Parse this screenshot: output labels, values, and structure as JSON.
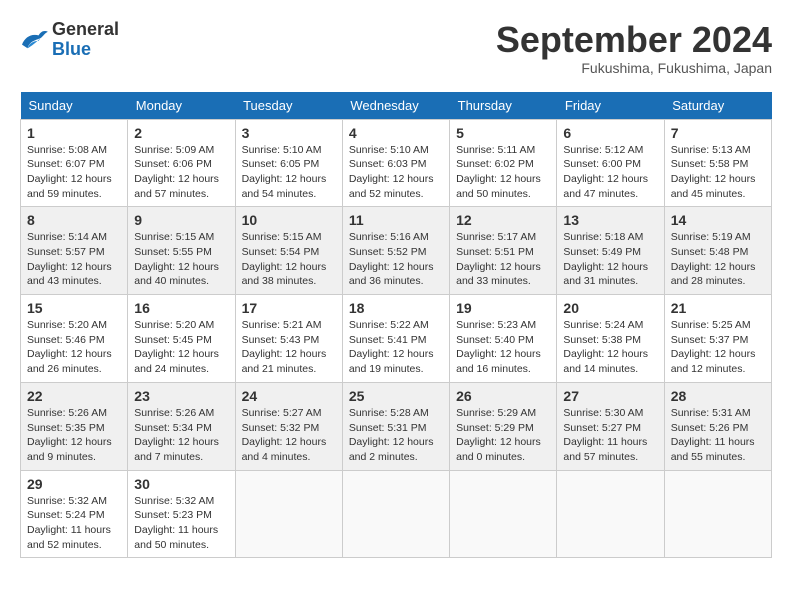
{
  "header": {
    "logo_line1": "General",
    "logo_line2": "Blue",
    "month_title": "September 2024",
    "subtitle": "Fukushima, Fukushima, Japan"
  },
  "days_of_week": [
    "Sunday",
    "Monday",
    "Tuesday",
    "Wednesday",
    "Thursday",
    "Friday",
    "Saturday"
  ],
  "weeks": [
    [
      {
        "day": "1",
        "sunrise": "Sunrise: 5:08 AM",
        "sunset": "Sunset: 6:07 PM",
        "daylight": "Daylight: 12 hours and 59 minutes."
      },
      {
        "day": "2",
        "sunrise": "Sunrise: 5:09 AM",
        "sunset": "Sunset: 6:06 PM",
        "daylight": "Daylight: 12 hours and 57 minutes."
      },
      {
        "day": "3",
        "sunrise": "Sunrise: 5:10 AM",
        "sunset": "Sunset: 6:05 PM",
        "daylight": "Daylight: 12 hours and 54 minutes."
      },
      {
        "day": "4",
        "sunrise": "Sunrise: 5:10 AM",
        "sunset": "Sunset: 6:03 PM",
        "daylight": "Daylight: 12 hours and 52 minutes."
      },
      {
        "day": "5",
        "sunrise": "Sunrise: 5:11 AM",
        "sunset": "Sunset: 6:02 PM",
        "daylight": "Daylight: 12 hours and 50 minutes."
      },
      {
        "day": "6",
        "sunrise": "Sunrise: 5:12 AM",
        "sunset": "Sunset: 6:00 PM",
        "daylight": "Daylight: 12 hours and 47 minutes."
      },
      {
        "day": "7",
        "sunrise": "Sunrise: 5:13 AM",
        "sunset": "Sunset: 5:58 PM",
        "daylight": "Daylight: 12 hours and 45 minutes."
      }
    ],
    [
      {
        "day": "8",
        "sunrise": "Sunrise: 5:14 AM",
        "sunset": "Sunset: 5:57 PM",
        "daylight": "Daylight: 12 hours and 43 minutes."
      },
      {
        "day": "9",
        "sunrise": "Sunrise: 5:15 AM",
        "sunset": "Sunset: 5:55 PM",
        "daylight": "Daylight: 12 hours and 40 minutes."
      },
      {
        "day": "10",
        "sunrise": "Sunrise: 5:15 AM",
        "sunset": "Sunset: 5:54 PM",
        "daylight": "Daylight: 12 hours and 38 minutes."
      },
      {
        "day": "11",
        "sunrise": "Sunrise: 5:16 AM",
        "sunset": "Sunset: 5:52 PM",
        "daylight": "Daylight: 12 hours and 36 minutes."
      },
      {
        "day": "12",
        "sunrise": "Sunrise: 5:17 AM",
        "sunset": "Sunset: 5:51 PM",
        "daylight": "Daylight: 12 hours and 33 minutes."
      },
      {
        "day": "13",
        "sunrise": "Sunrise: 5:18 AM",
        "sunset": "Sunset: 5:49 PM",
        "daylight": "Daylight: 12 hours and 31 minutes."
      },
      {
        "day": "14",
        "sunrise": "Sunrise: 5:19 AM",
        "sunset": "Sunset: 5:48 PM",
        "daylight": "Daylight: 12 hours and 28 minutes."
      }
    ],
    [
      {
        "day": "15",
        "sunrise": "Sunrise: 5:20 AM",
        "sunset": "Sunset: 5:46 PM",
        "daylight": "Daylight: 12 hours and 26 minutes."
      },
      {
        "day": "16",
        "sunrise": "Sunrise: 5:20 AM",
        "sunset": "Sunset: 5:45 PM",
        "daylight": "Daylight: 12 hours and 24 minutes."
      },
      {
        "day": "17",
        "sunrise": "Sunrise: 5:21 AM",
        "sunset": "Sunset: 5:43 PM",
        "daylight": "Daylight: 12 hours and 21 minutes."
      },
      {
        "day": "18",
        "sunrise": "Sunrise: 5:22 AM",
        "sunset": "Sunset: 5:41 PM",
        "daylight": "Daylight: 12 hours and 19 minutes."
      },
      {
        "day": "19",
        "sunrise": "Sunrise: 5:23 AM",
        "sunset": "Sunset: 5:40 PM",
        "daylight": "Daylight: 12 hours and 16 minutes."
      },
      {
        "day": "20",
        "sunrise": "Sunrise: 5:24 AM",
        "sunset": "Sunset: 5:38 PM",
        "daylight": "Daylight: 12 hours and 14 minutes."
      },
      {
        "day": "21",
        "sunrise": "Sunrise: 5:25 AM",
        "sunset": "Sunset: 5:37 PM",
        "daylight": "Daylight: 12 hours and 12 minutes."
      }
    ],
    [
      {
        "day": "22",
        "sunrise": "Sunrise: 5:26 AM",
        "sunset": "Sunset: 5:35 PM",
        "daylight": "Daylight: 12 hours and 9 minutes."
      },
      {
        "day": "23",
        "sunrise": "Sunrise: 5:26 AM",
        "sunset": "Sunset: 5:34 PM",
        "daylight": "Daylight: 12 hours and 7 minutes."
      },
      {
        "day": "24",
        "sunrise": "Sunrise: 5:27 AM",
        "sunset": "Sunset: 5:32 PM",
        "daylight": "Daylight: 12 hours and 4 minutes."
      },
      {
        "day": "25",
        "sunrise": "Sunrise: 5:28 AM",
        "sunset": "Sunset: 5:31 PM",
        "daylight": "Daylight: 12 hours and 2 minutes."
      },
      {
        "day": "26",
        "sunrise": "Sunrise: 5:29 AM",
        "sunset": "Sunset: 5:29 PM",
        "daylight": "Daylight: 12 hours and 0 minutes."
      },
      {
        "day": "27",
        "sunrise": "Sunrise: 5:30 AM",
        "sunset": "Sunset: 5:27 PM",
        "daylight": "Daylight: 11 hours and 57 minutes."
      },
      {
        "day": "28",
        "sunrise": "Sunrise: 5:31 AM",
        "sunset": "Sunset: 5:26 PM",
        "daylight": "Daylight: 11 hours and 55 minutes."
      }
    ],
    [
      {
        "day": "29",
        "sunrise": "Sunrise: 5:32 AM",
        "sunset": "Sunset: 5:24 PM",
        "daylight": "Daylight: 11 hours and 52 minutes."
      },
      {
        "day": "30",
        "sunrise": "Sunrise: 5:32 AM",
        "sunset": "Sunset: 5:23 PM",
        "daylight": "Daylight: 11 hours and 50 minutes."
      },
      null,
      null,
      null,
      null,
      null
    ]
  ]
}
